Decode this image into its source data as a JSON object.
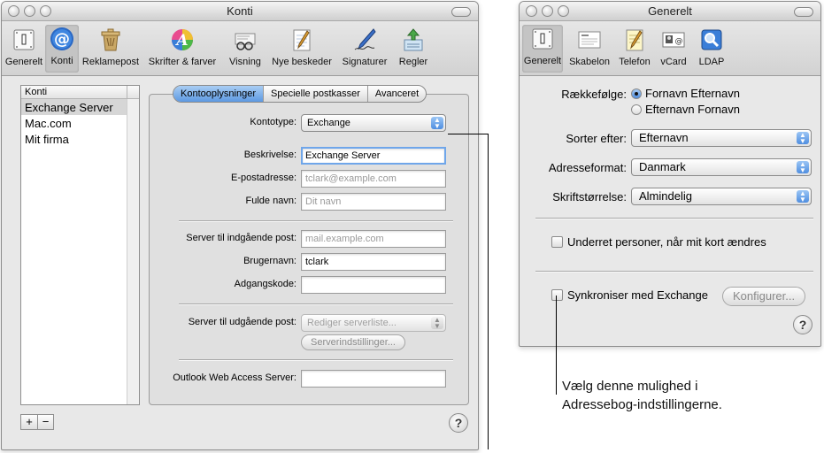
{
  "window1": {
    "title": "Konti",
    "toolbar": [
      {
        "label": "Generelt",
        "icon": "general-switch-icon"
      },
      {
        "label": "Konti",
        "icon": "at-sign-icon"
      },
      {
        "label": "Reklamepost",
        "icon": "trash-bin-icon"
      },
      {
        "label": "Skrifter & farver",
        "icon": "font-color-icon"
      },
      {
        "label": "Visning",
        "icon": "glasses-icon"
      },
      {
        "label": "Nye beskeder",
        "icon": "notepad-pencil-icon"
      },
      {
        "label": "Signaturer",
        "icon": "pen-icon"
      },
      {
        "label": "Regler",
        "icon": "rules-arrows-icon"
      }
    ],
    "selected_toolbar": "Konti",
    "accounts_header": "Konti",
    "accounts": [
      "Exchange Server",
      "Mac.com",
      "Mit firma"
    ],
    "selected_account": "Exchange Server",
    "add_label": "+",
    "remove_label": "−",
    "tabs": [
      "Kontooplysninger",
      "Specielle postkasser",
      "Avanceret"
    ],
    "active_tab": "Kontooplysninger",
    "form": {
      "account_type_label": "Kontotype:",
      "account_type_value": "Exchange",
      "description_label": "Beskrivelse:",
      "description_value": "Exchange Server",
      "email_label": "E-postadresse:",
      "email_placeholder": "tclark@example.com",
      "fullname_label": "Fulde navn:",
      "fullname_placeholder": "Dit navn",
      "incoming_label": "Server til indgående post:",
      "incoming_placeholder": "mail.example.com",
      "username_label": "Brugernavn:",
      "username_value": "tclark",
      "password_label": "Adgangskode:",
      "password_value": "",
      "outgoing_label": "Server til udgående post:",
      "outgoing_value": "Rediger serverliste...",
      "server_settings_button": "Serverindstillinger...",
      "owa_label": "Outlook Web Access Server:",
      "owa_value": ""
    },
    "help_label": "?"
  },
  "window2": {
    "title": "Generelt",
    "toolbar": [
      {
        "label": "Generelt",
        "icon": "general-switch-icon"
      },
      {
        "label": "Skabelon",
        "icon": "template-icon"
      },
      {
        "label": "Telefon",
        "icon": "notepad-icon"
      },
      {
        "label": "vCard",
        "icon": "vcard-icon"
      },
      {
        "label": "LDAP",
        "icon": "ldap-search-icon"
      }
    ],
    "selected_toolbar": "Generelt",
    "order_label": "Rækkefølge:",
    "order_options": [
      "Fornavn Efternavn",
      "Efternavn Fornavn"
    ],
    "order_selected": "Fornavn Efternavn",
    "sort_label": "Sorter efter:",
    "sort_value": "Efternavn",
    "format_label": "Adresseformat:",
    "format_value": "Danmark",
    "fontsize_label": "Skriftstørrelse:",
    "fontsize_value": "Almindelig",
    "notify_label": "Underret personer, når mit kort ændres",
    "notify_checked": false,
    "sync_label": "Synkroniser med Exchange",
    "sync_checked": false,
    "configure_button": "Konfigurer...",
    "help_label": "?"
  },
  "callout": {
    "line1": "Vælg denne mulighed i",
    "line2": "Adressebog-indstillingerne."
  },
  "colors": {
    "accent_blue": "#5d99e2",
    "window_bg": "#e8e8e8",
    "selection_gray": "#d6d6d6"
  }
}
